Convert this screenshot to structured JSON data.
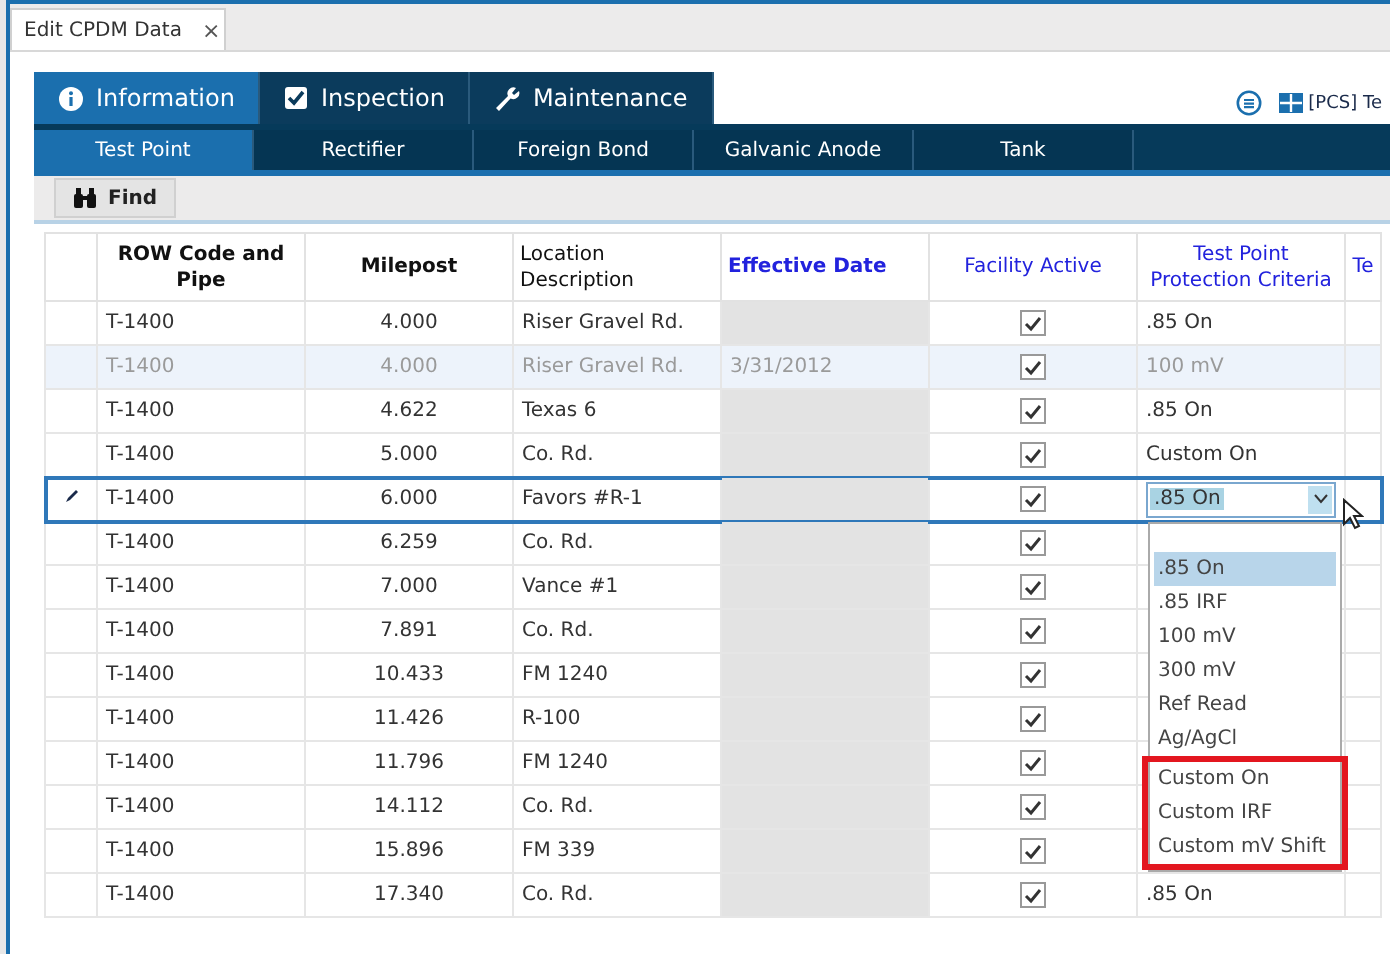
{
  "document_tab": {
    "title": "Edit CPDM Data",
    "close": "×"
  },
  "main_tabs": [
    {
      "label": "Information",
      "selected": true
    },
    {
      "label": "Inspection",
      "selected": false
    },
    {
      "label": "Maintenance",
      "selected": false
    }
  ],
  "toolbar_right": {
    "layout_label": "[PCS] Te"
  },
  "sub_tabs": [
    {
      "label": "Test Point",
      "selected": true
    },
    {
      "label": "Rectifier",
      "selected": false
    },
    {
      "label": "Foreign Bond",
      "selected": false
    },
    {
      "label": "Galvanic Anode",
      "selected": false
    },
    {
      "label": "Tank",
      "selected": false
    }
  ],
  "find_button": "Find",
  "table": {
    "columns": [
      {
        "label": "ROW Code and Pipe"
      },
      {
        "label": "Milepost"
      },
      {
        "label": "Location Description"
      },
      {
        "label": "Effective Date"
      },
      {
        "label": "Facility Active"
      },
      {
        "label": "Test Point Protection Criteria"
      },
      {
        "label": "Te"
      }
    ],
    "rows": [
      {
        "row_code": "T-1400",
        "milepost": "4.000",
        "location": "Riser Gravel Rd.",
        "facility_active": true,
        "criteria": ".85 On",
        "editing": false,
        "dimmed": false
      },
      {
        "row_code": "T-1400",
        "milepost": "4.000",
        "location": "Riser Gravel Rd.",
        "effective_date": "3/31/2012",
        "facility_active": true,
        "criteria": "100 mV",
        "editing": false,
        "dimmed": true
      },
      {
        "row_code": "T-1400",
        "milepost": "4.622",
        "location": "Texas 6",
        "facility_active": true,
        "criteria": ".85 On",
        "editing": false,
        "dimmed": false
      },
      {
        "row_code": "T-1400",
        "milepost": "5.000",
        "location": "Co. Rd.",
        "facility_active": true,
        "criteria": "Custom On",
        "editing": false,
        "dimmed": false
      },
      {
        "row_code": "T-1400",
        "milepost": "6.000",
        "location": "Favors #R-1",
        "facility_active": true,
        "criteria": ".85 On",
        "editing": true,
        "dimmed": false
      },
      {
        "row_code": "T-1400",
        "milepost": "6.259",
        "location": "Co. Rd.",
        "facility_active": true,
        "editing": false,
        "dimmed": false
      },
      {
        "row_code": "T-1400",
        "milepost": "7.000",
        "location": "Vance #1",
        "facility_active": true,
        "editing": false,
        "dimmed": false
      },
      {
        "row_code": "T-1400",
        "milepost": "7.891",
        "location": "Co. Rd.",
        "facility_active": true,
        "editing": false,
        "dimmed": false
      },
      {
        "row_code": "T-1400",
        "milepost": "10.433",
        "location": "FM 1240",
        "facility_active": true,
        "editing": false,
        "dimmed": false
      },
      {
        "row_code": "T-1400",
        "milepost": "11.426",
        "location": "R-100",
        "facility_active": true,
        "editing": false,
        "dimmed": false
      },
      {
        "row_code": "T-1400",
        "milepost": "11.796",
        "location": "FM 1240",
        "facility_active": true,
        "editing": false,
        "dimmed": false
      },
      {
        "row_code": "T-1400",
        "milepost": "14.112",
        "location": "Co. Rd.",
        "facility_active": true,
        "editing": false,
        "dimmed": false
      },
      {
        "row_code": "T-1400",
        "milepost": "15.896",
        "location": "FM 339",
        "facility_active": true,
        "editing": false,
        "dimmed": false
      },
      {
        "row_code": "T-1400",
        "milepost": "17.340",
        "location": "Co. Rd.",
        "facility_active": true,
        "criteria": ".85 On",
        "editing": false,
        "dimmed": false
      }
    ]
  },
  "dropdown": {
    "options": [
      {
        "label": ".85 On",
        "selected": true,
        "annotated": false
      },
      {
        "label": ".85 IRF",
        "selected": false,
        "annotated": false
      },
      {
        "label": "100 mV",
        "selected": false,
        "annotated": false
      },
      {
        "label": "300 mV",
        "selected": false,
        "annotated": false
      },
      {
        "label": "Ref Read",
        "selected": false,
        "annotated": false
      },
      {
        "label": "Ag/AgCl",
        "selected": false,
        "annotated": false
      },
      {
        "label": "Custom On",
        "selected": false,
        "annotated": true
      },
      {
        "label": "Custom IRF",
        "selected": false,
        "annotated": true
      },
      {
        "label": "Custom mV Shift",
        "selected": false,
        "annotated": true
      }
    ]
  }
}
